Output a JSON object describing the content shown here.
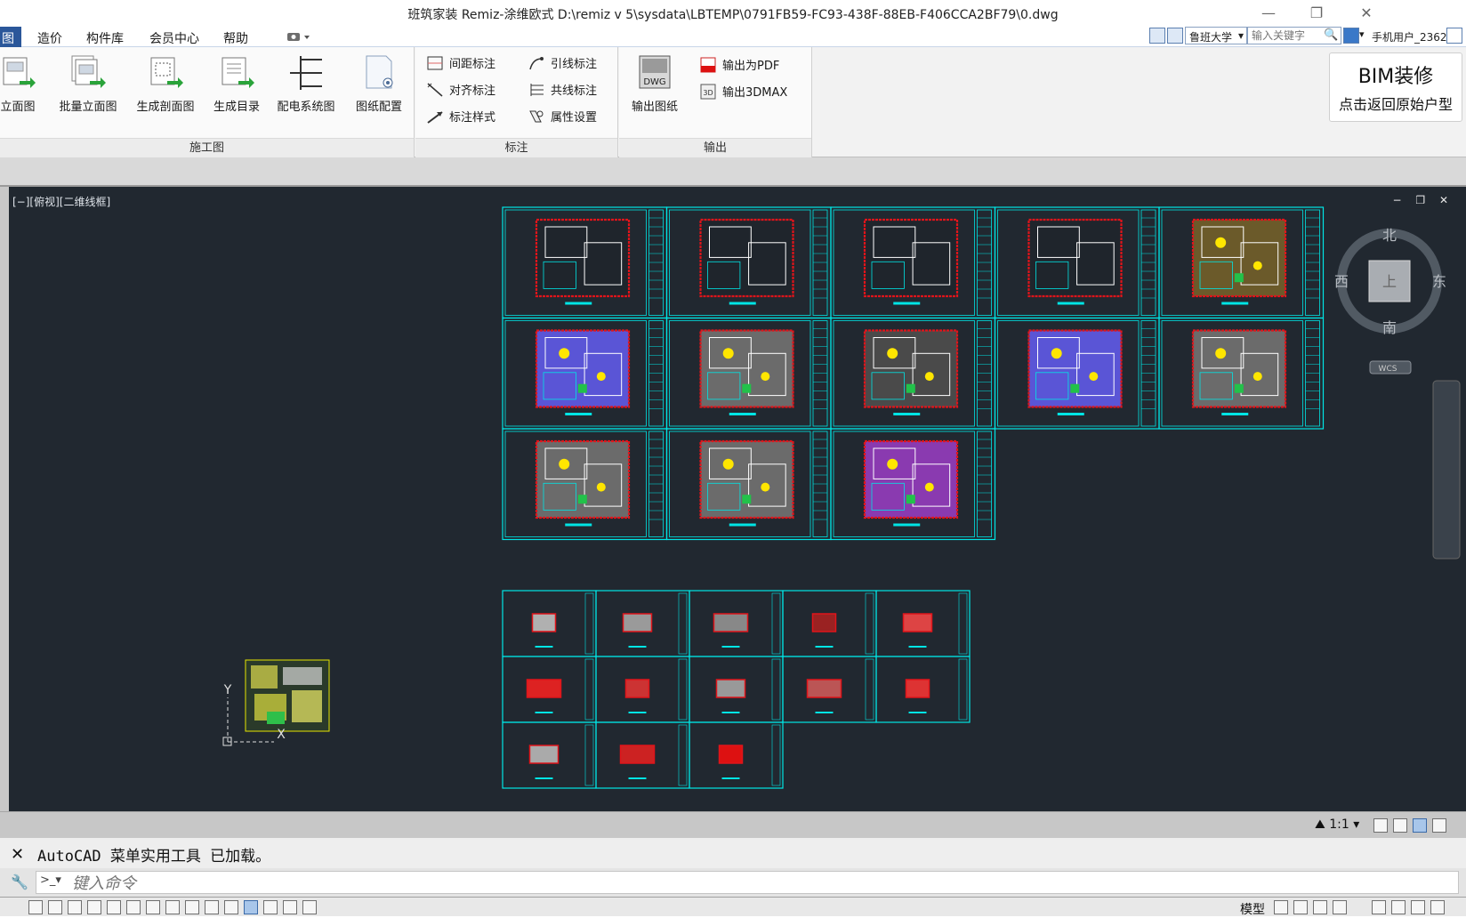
{
  "window": {
    "title": "班筑家装 Remiz-涂维欧式    D:\\remiz v 5\\sysdata\\LBTEMP\\0791FB59-FC93-438F-88EB-F406CCA2BF79\\0.dwg",
    "minimize": "—",
    "restore": "❐",
    "close": "✕"
  },
  "menu": {
    "items": [
      {
        "label": "图",
        "active": true
      },
      {
        "label": "造价"
      },
      {
        "label": "构件库"
      },
      {
        "label": "会员中心"
      },
      {
        "label": "帮助"
      }
    ],
    "workspace": "鲁班大学",
    "search_placeholder": "输入关键字",
    "user": "手机用户_2362"
  },
  "ribbon": {
    "panels": [
      {
        "title": "施工图",
        "buttons": [
          {
            "label": "立面图"
          },
          {
            "label": "批量立面图"
          },
          {
            "label": "生成剖面图"
          },
          {
            "label": "生成目录"
          },
          {
            "label": "配电系统图"
          },
          {
            "label": "图纸配置"
          }
        ]
      },
      {
        "title": "标注",
        "buttons": [
          {
            "label": "间距标注"
          },
          {
            "label": "对齐标注"
          },
          {
            "label": "标注样式"
          },
          {
            "label": "引线标注"
          },
          {
            "label": "共线标注"
          },
          {
            "label": "属性设置"
          }
        ]
      },
      {
        "title": "输出",
        "buttons": [
          {
            "label": "输出图纸"
          },
          {
            "label": "输出为PDF"
          },
          {
            "label": "输出3DMAX"
          }
        ]
      }
    ],
    "bim": {
      "line1": "BIM装修",
      "line2": "点击返回原始户型"
    }
  },
  "viewport": {
    "label": "[−][俯视][二维线框]",
    "controls": "− ❐ ✕",
    "viewcube": {
      "north": "北",
      "south": "南",
      "west": "西",
      "east": "东",
      "face": "上",
      "ucs": "WCS"
    },
    "ucs_axis": {
      "y": "Y",
      "x": "X"
    },
    "scale": "1:1"
  },
  "command": {
    "history": "AutoCAD 菜单实用工具 已加载。",
    "placeholder": "键入命令"
  },
  "statusbar": {
    "model": "模型"
  },
  "colors": {
    "canvas": "#212830",
    "sheet_border": "#00e5e5",
    "plan_red": "#e0141a",
    "ribbon_bg": "#f2f2f2",
    "active_tab": "#2b579a"
  }
}
